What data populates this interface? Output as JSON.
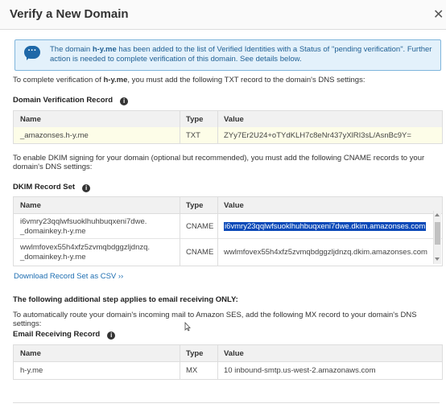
{
  "dialog": {
    "title": "Verify a New Domain",
    "close": "✕"
  },
  "info": {
    "pre": "The domain ",
    "domain": "h-y.me",
    "post": " has been added to the list of Verified Identities with a Status of \"pending verification\". Further action is needed to complete verification of this domain. See details below."
  },
  "txt_intro": {
    "pre": "To complete verification of ",
    "domain": "h-y.me",
    "post": ", you must add the following TXT record to the domain's DNS settings:"
  },
  "domain_verification": {
    "title": "Domain Verification Record",
    "headers": {
      "name": "Name",
      "type": "Type",
      "value": "Value"
    },
    "row": {
      "name": "_amazonses.h-y.me",
      "type": "TXT",
      "value": "ZYy7Er2U24+oTYdKLH7c8eNr437yXlRI3sL/AsnBc9Y="
    }
  },
  "dkim_intro": "To enable DKIM signing for your domain (optional but recommended), you must add the following CNAME records to your domain's DNS settings:",
  "dkim": {
    "title": "DKIM Record Set",
    "headers": {
      "name": "Name",
      "type": "Type",
      "value": "Value"
    },
    "rows": [
      {
        "name_line1": "i6vmry23qqlwfsuoklhuhbuqxeni7dwe.",
        "name_line2": "_domainkey.h-y.me",
        "type": "CNAME",
        "value": "i6vmry23qqlwfsuoklhuhbuqxeni7dwe.dkim.amazonses.com"
      },
      {
        "name_line1": "wwlmfovex55h4xfz5zvmqbdggzljdnzq.",
        "name_line2": "_domainkey.h-y.me",
        "type": "CNAME",
        "value": "wwlmfovex55h4xfz5zvmqbdggzljdnzq.dkim.amazonses.com"
      }
    ]
  },
  "download_link": "Download Record Set as CSV ››",
  "receiving_heading": "The following additional step applies to email receiving ONLY:",
  "receiving_intro": "To automatically route your domain's incoming mail to Amazon SES, add the following MX record to your domain's DNS settings:",
  "email_receiving": {
    "title": "Email Receiving Record",
    "headers": {
      "name": "Name",
      "type": "Type",
      "value": "Value"
    },
    "row": {
      "name": "h-y.me",
      "type": "MX",
      "value": "10 inbound-smtp.us-west-2.amazonaws.com"
    }
  },
  "icons": {
    "info": "chat-bubble-icon",
    "help": "info-circle-icon",
    "cursor": "text-cursor-icon"
  },
  "colors": {
    "accent_link": "#1c6db1",
    "info_bg": "#e3f1fb",
    "selection": "#0a49b8",
    "highlight_row": "#fdfde8"
  }
}
